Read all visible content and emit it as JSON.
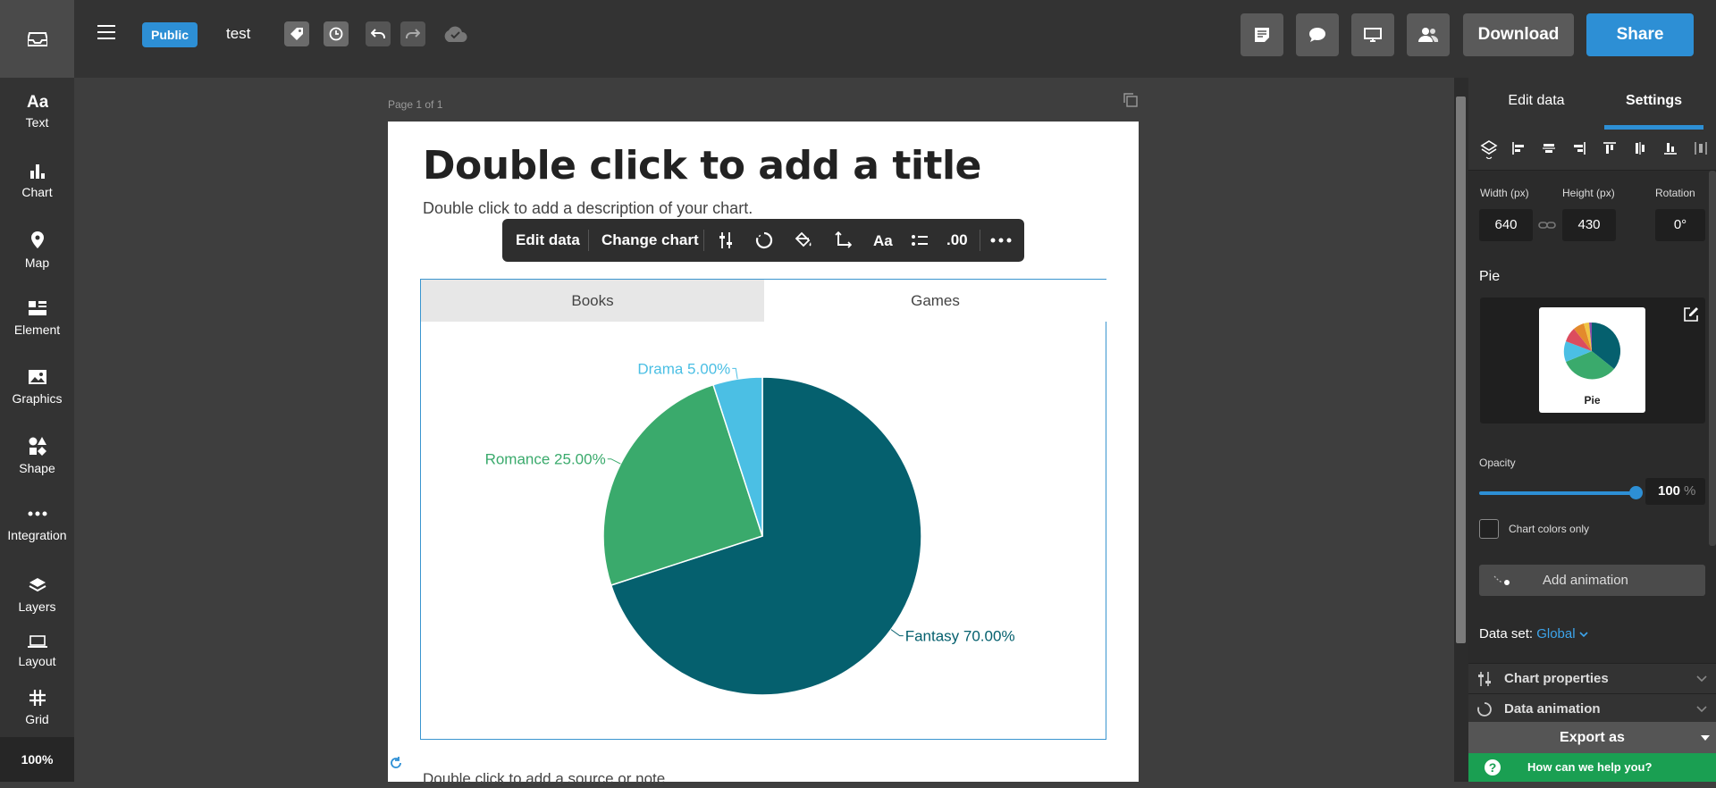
{
  "topbar": {
    "visibility_badge": "Public",
    "doc_name": "test",
    "download_label": "Download",
    "share_label": "Share"
  },
  "sidebar": {
    "items": [
      {
        "label": "Text",
        "icon": "text-icon"
      },
      {
        "label": "Chart",
        "icon": "bar-chart-icon"
      },
      {
        "label": "Map",
        "icon": "map-pin-icon"
      },
      {
        "label": "Element",
        "icon": "element-icon"
      },
      {
        "label": "Graphics",
        "icon": "image-icon"
      },
      {
        "label": "Shape",
        "icon": "shapes-icon"
      },
      {
        "label": "Integration",
        "icon": "dots-icon"
      },
      {
        "label": "Layers",
        "icon": "layers-icon"
      },
      {
        "label": "Layout",
        "icon": "layout-icon"
      },
      {
        "label": "Grid",
        "icon": "grid-icon"
      }
    ],
    "zoom": "100%"
  },
  "canvas": {
    "page_label": "Page 1 of 1",
    "title": "Double click to add a title",
    "description": "Double click to add a description of your chart.",
    "source_note": "Double click to add a source or note"
  },
  "float_toolbar": {
    "edit_data": "Edit data",
    "change_chart": "Change chart",
    "decimals": ".00"
  },
  "chart_tabs": [
    "Books",
    "Games"
  ],
  "chart_data": {
    "type": "pie",
    "slices": [
      {
        "label": "Fantasy",
        "value": 70.0,
        "display": "Fantasy 70.00%",
        "color": "#05606e"
      },
      {
        "label": "Romance",
        "value": 25.0,
        "display": "Romance 25.00%",
        "color": "#3aaa6c"
      },
      {
        "label": "Drama",
        "value": 5.0,
        "display": "Drama 5.00%",
        "color": "#4bbfe4"
      }
    ]
  },
  "panel": {
    "tabs": {
      "edit": "Edit data",
      "settings": "Settings"
    },
    "width_label": "Width (px)",
    "width_value": "640",
    "height_label": "Height (px)",
    "height_value": "430",
    "rotation_label": "Rotation",
    "rotation_value": "0°",
    "chart_type": "Pie",
    "thumb_label": "Pie",
    "opacity_label": "Opacity",
    "opacity_value": "100",
    "opacity_unit": "%",
    "opacity_level": 1.0,
    "chart_colors_only": "Chart colors only",
    "add_animation": "Add animation",
    "dataset_label": "Data set:",
    "dataset_value": "Global",
    "chart_properties": "Chart properties",
    "data_animation": "Data animation",
    "export_as": "Export as",
    "help": "How can we help you?"
  },
  "colors": {
    "accent": "#2d8fd5",
    "help_green": "#1a9f52",
    "topbar": "#333333",
    "canvas_bg": "#3e3e3e"
  }
}
